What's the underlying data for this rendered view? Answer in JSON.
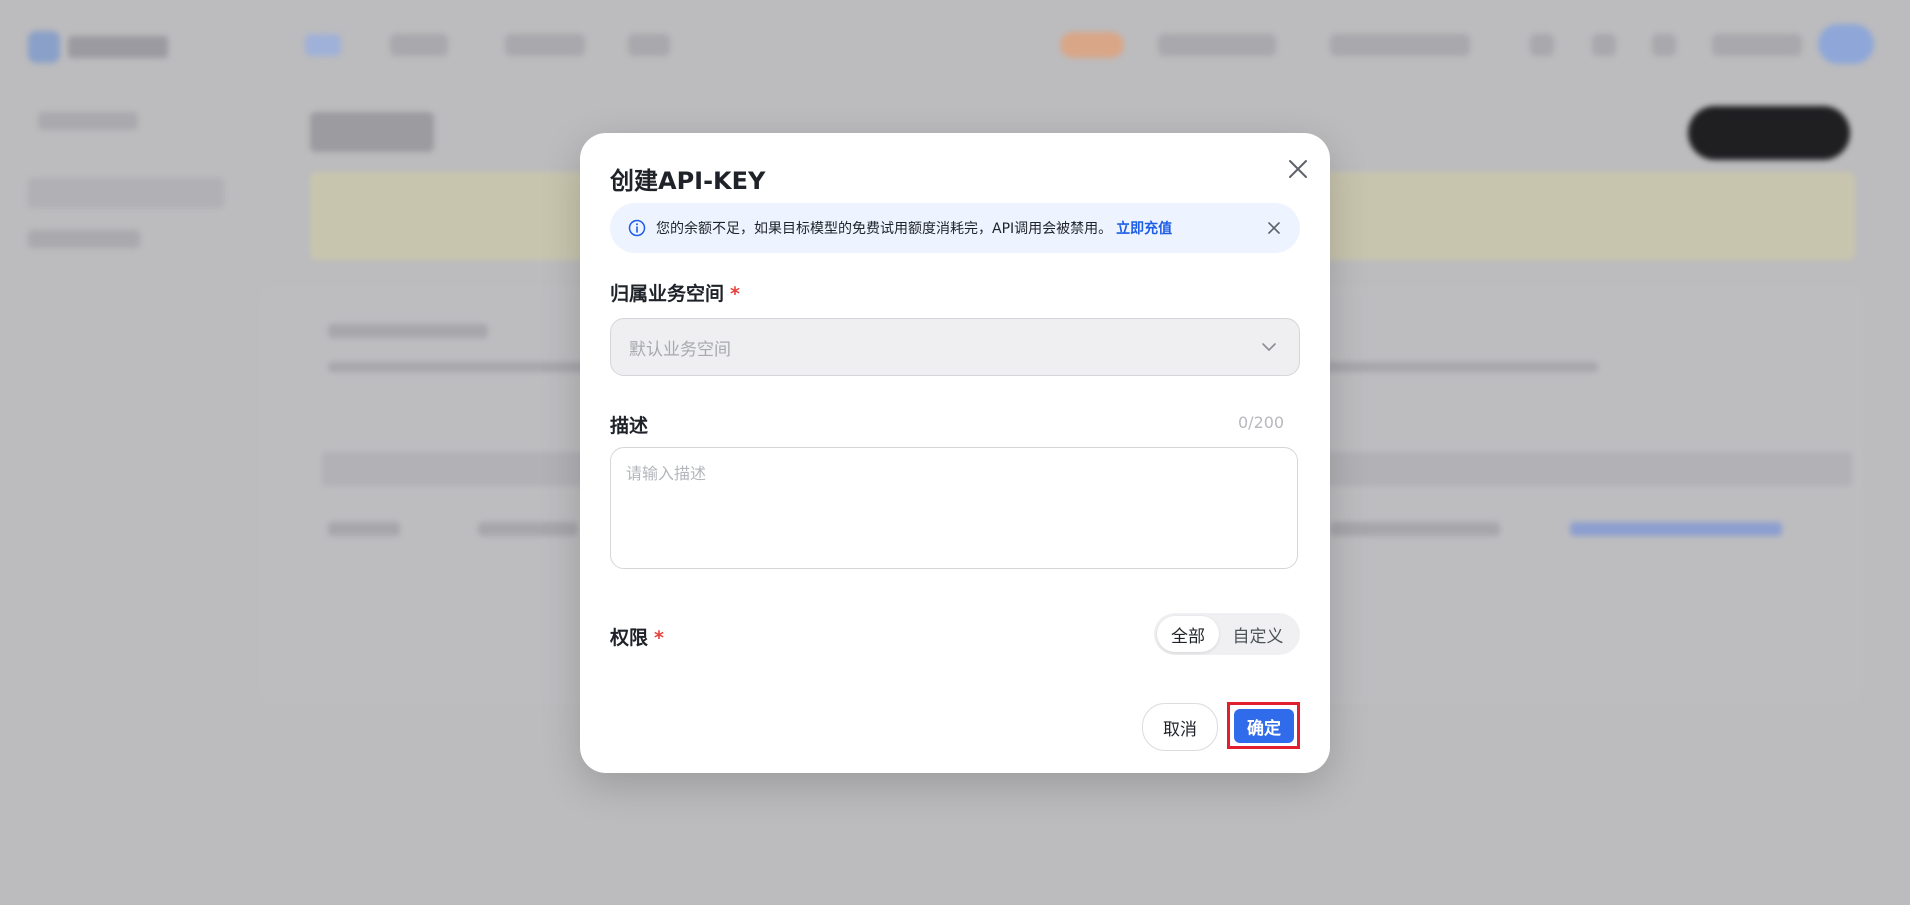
{
  "modal": {
    "title": "创建API-KEY",
    "alert": {
      "text": "您的余额不足，如果目标模型的免费试用额度消耗完，API调用会被禁用。",
      "link": "立即充值"
    },
    "workspace": {
      "label": "归属业务空间",
      "required_mark": "*",
      "value": "默认业务空间"
    },
    "description": {
      "label": "描述",
      "counter": "0/200",
      "placeholder": "请输入描述"
    },
    "permission": {
      "label": "权限",
      "required_mark": "*",
      "options": [
        "全部",
        "自定义"
      ],
      "selected": "全部"
    },
    "buttons": {
      "cancel": "取消",
      "confirm": "确定"
    }
  },
  "colors": {
    "primary": "#2f6bea",
    "link": "#1e5ee6",
    "required": "#e8413c",
    "highlight_frame": "#e21f2c",
    "alert_bg": "#eef4ff"
  },
  "icons": [
    "close-icon",
    "info-icon",
    "chevron-down-icon"
  ]
}
